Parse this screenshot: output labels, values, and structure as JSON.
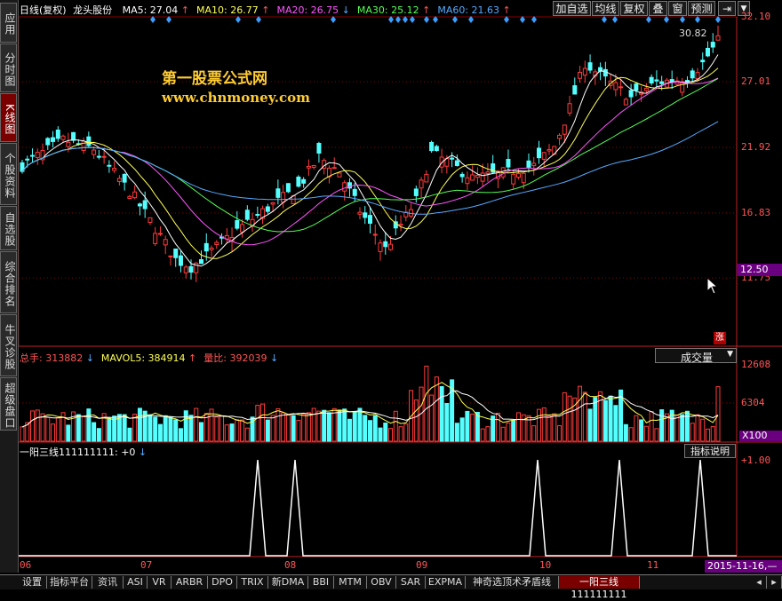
{
  "sidebar": {
    "tabs": [
      {
        "label": "应用",
        "active": false
      },
      {
        "label": "分时图",
        "active": false
      },
      {
        "label": "K线图",
        "active": true
      },
      {
        "label": "个股资料",
        "active": false
      },
      {
        "label": "自选股",
        "active": false
      },
      {
        "label": "综合排名",
        "active": false
      },
      {
        "label": "牛叉诊股",
        "active": false
      },
      {
        "label": "超级盘口",
        "active": false
      }
    ]
  },
  "header": {
    "period": "日线(复权)",
    "stock_name": "龙头股份",
    "ma": [
      {
        "label": "MA5:",
        "value": "27.04",
        "arrow": "↑",
        "color": "#ffffff"
      },
      {
        "label": "MA10:",
        "value": "26.77",
        "arrow": "↑",
        "color": "#ffff55"
      },
      {
        "label": "MA20:",
        "value": "26.75",
        "arrow": "↓",
        "color": "#ff55ff"
      },
      {
        "label": "MA30:",
        "value": "25.12",
        "arrow": "↑",
        "color": "#55ff55"
      },
      {
        "label": "MA60:",
        "value": "21.63",
        "arrow": "↑",
        "color": "#55aaff"
      }
    ]
  },
  "toolbar": {
    "buttons": [
      "加自选",
      "均线",
      "复权",
      "叠",
      "窗",
      "预测"
    ],
    "nav_icon": "panel-switch-icon",
    "dropdown_icon": "chevron-down-icon"
  },
  "watermark": {
    "title": "第一股票公式网",
    "url": "www.chnmoney.com"
  },
  "price_axis": {
    "labels": [
      "32.10",
      "27.01",
      "21.92",
      "16.83",
      "11.75"
    ],
    "current_price": "12.50",
    "max_marker": "30.82",
    "rise_badge": "涨"
  },
  "volume_panel": {
    "legend": [
      {
        "label": "总手:",
        "value": "313882",
        "arrow": "↓",
        "color": "#ff5555"
      },
      {
        "label": "MAVOL5:",
        "value": "384914",
        "arrow": "↑",
        "color": "#ffff55"
      },
      {
        "label": "量比:",
        "value": "392039",
        "arrow": "↓",
        "color": "#ff5555"
      }
    ],
    "dropdown": "成交量",
    "axis_labels": [
      "12608",
      "6304"
    ],
    "unit": "X100"
  },
  "indicator_panel": {
    "name": "一阳三线111111111:",
    "value": "+0",
    "arrow": "↓",
    "help_button": "指标说明",
    "axis_label": "+1.00"
  },
  "date_axis": {
    "labels": [
      "06",
      "07",
      "08",
      "09",
      "10",
      "11"
    ],
    "cursor_date": "2015-11-16,—"
  },
  "bottom_tabs": [
    "设置",
    "指标平台",
    "资讯",
    "ASI",
    "VR",
    "ARBR",
    "DPO",
    "TRIX",
    "新DMA",
    "BBI",
    "MTM",
    "OBV",
    "SAR",
    "EXPMA",
    "神奇选顶术矛盾线",
    "一阳三线111111111"
  ],
  "chart_data": {
    "type": "candlestick",
    "y_range": [
      11.75,
      32.1
    ],
    "ma_series": [
      "MA5",
      "MA10",
      "MA20",
      "MA30",
      "MA60"
    ],
    "signal_spikes": 5,
    "colors": {
      "up": "#ff3b3b",
      "down": "#54ffff",
      "grid": "#8b0000",
      "signal": "#ffffff",
      "marker": "#3aa0ff"
    }
  }
}
